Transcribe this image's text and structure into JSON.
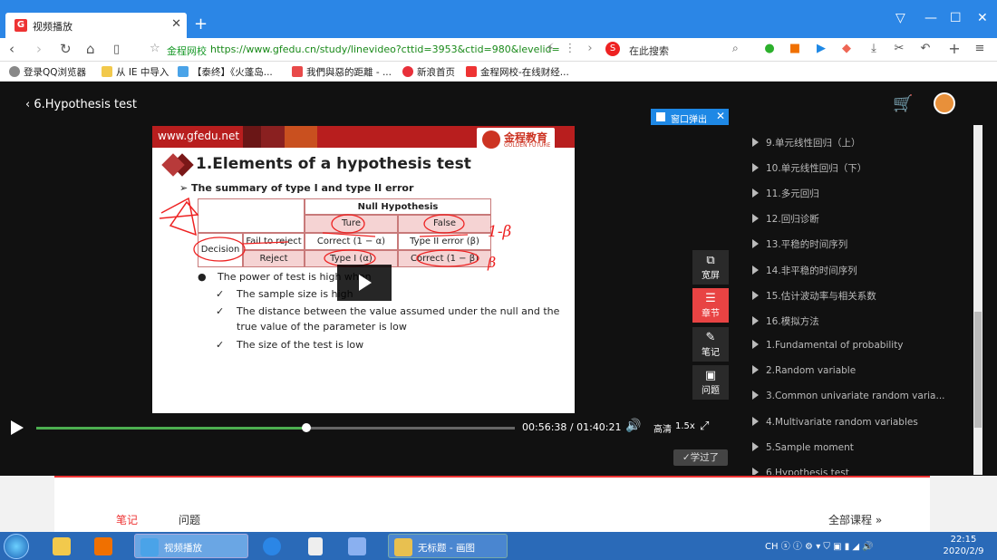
{
  "browser": {
    "tab_title": "视频播放",
    "tab_logo": "G",
    "url_site": "金程网校",
    "url": "https://www.gfedu.cn/study/linevideo?cttid=3953&ctid=980&levelid=",
    "search_label": "在此搜索",
    "search_logo": "S"
  },
  "bookmarks": [
    "登录QQ浏览器",
    "从 IE 中导入",
    "【泰终】《火蓬岛...",
    "我們與惡的距離 - ...",
    "新浪首页",
    "金程网校-在线财经..."
  ],
  "player": {
    "title": "6.Hypothesis test",
    "popout_label": "窗口弹出",
    "current_time": "00:56:38",
    "total_time": "01:40:21",
    "progress_fraction": 0.564,
    "quality": "高清",
    "speed": "1.5x",
    "learned_label": "学过了"
  },
  "slide": {
    "site": "www.gfedu.net",
    "brand": "金程教育",
    "brand_sub": "GOLDEN FUTURE",
    "title": "1.Elements of a hypothesis test",
    "subtitle": "The summary of type I and type II error",
    "table": {
      "null_hypothesis": "Null Hypothesis",
      "ture": "Ture",
      "false": "False",
      "decision": "Decision",
      "fail_to_reject": "Fail to reject",
      "reject": "Reject",
      "correct_1_alpha": "Correct (1 − α)",
      "type2": "Type II error (β)",
      "type1": "Type I (α)",
      "correct_1_beta": "Correct (1 − β)"
    },
    "annotations": [
      "1-β",
      "β"
    ],
    "bullet_main": "The power of test is high when",
    "bullets": [
      "The sample size is high",
      "The distance between the value assumed under the null and the",
      "true value of the parameter is low",
      "The size of the test is low"
    ]
  },
  "tools": [
    {
      "icon": "popout-icon",
      "label": "宽屏"
    },
    {
      "icon": "menu-icon",
      "label": "章节"
    },
    {
      "icon": "pen-icon",
      "label": "笔记"
    },
    {
      "icon": "chat-icon",
      "label": "问题"
    }
  ],
  "chapters": [
    "9.单元线性回归（上）",
    "10.单元线性回归（下）",
    "11.多元回归",
    "12.回归诊断",
    "13.平稳的时间序列",
    "14.非平稳的时间序列",
    "15.估计波动率与相关系数",
    "16.模拟方法",
    "1.Fundamental of probability",
    "2.Random variable",
    "3.Common univariate random varia...",
    "4.Multivariate random variables",
    "5.Sample moment",
    "6.Hypothesis test"
  ],
  "page": {
    "notes_tab": "笔记",
    "questions_tab": "问题",
    "all_courses": "全部课程"
  },
  "taskbar": {
    "buttons": [
      "视频播放",
      "无标题 - 画图"
    ],
    "ime": "CH",
    "time": "22:15",
    "date": "2020/2/9"
  },
  "colors": {
    "accent": "#e33333",
    "browser_blue": "#2b86e6",
    "progress_green": "#4caf50"
  }
}
